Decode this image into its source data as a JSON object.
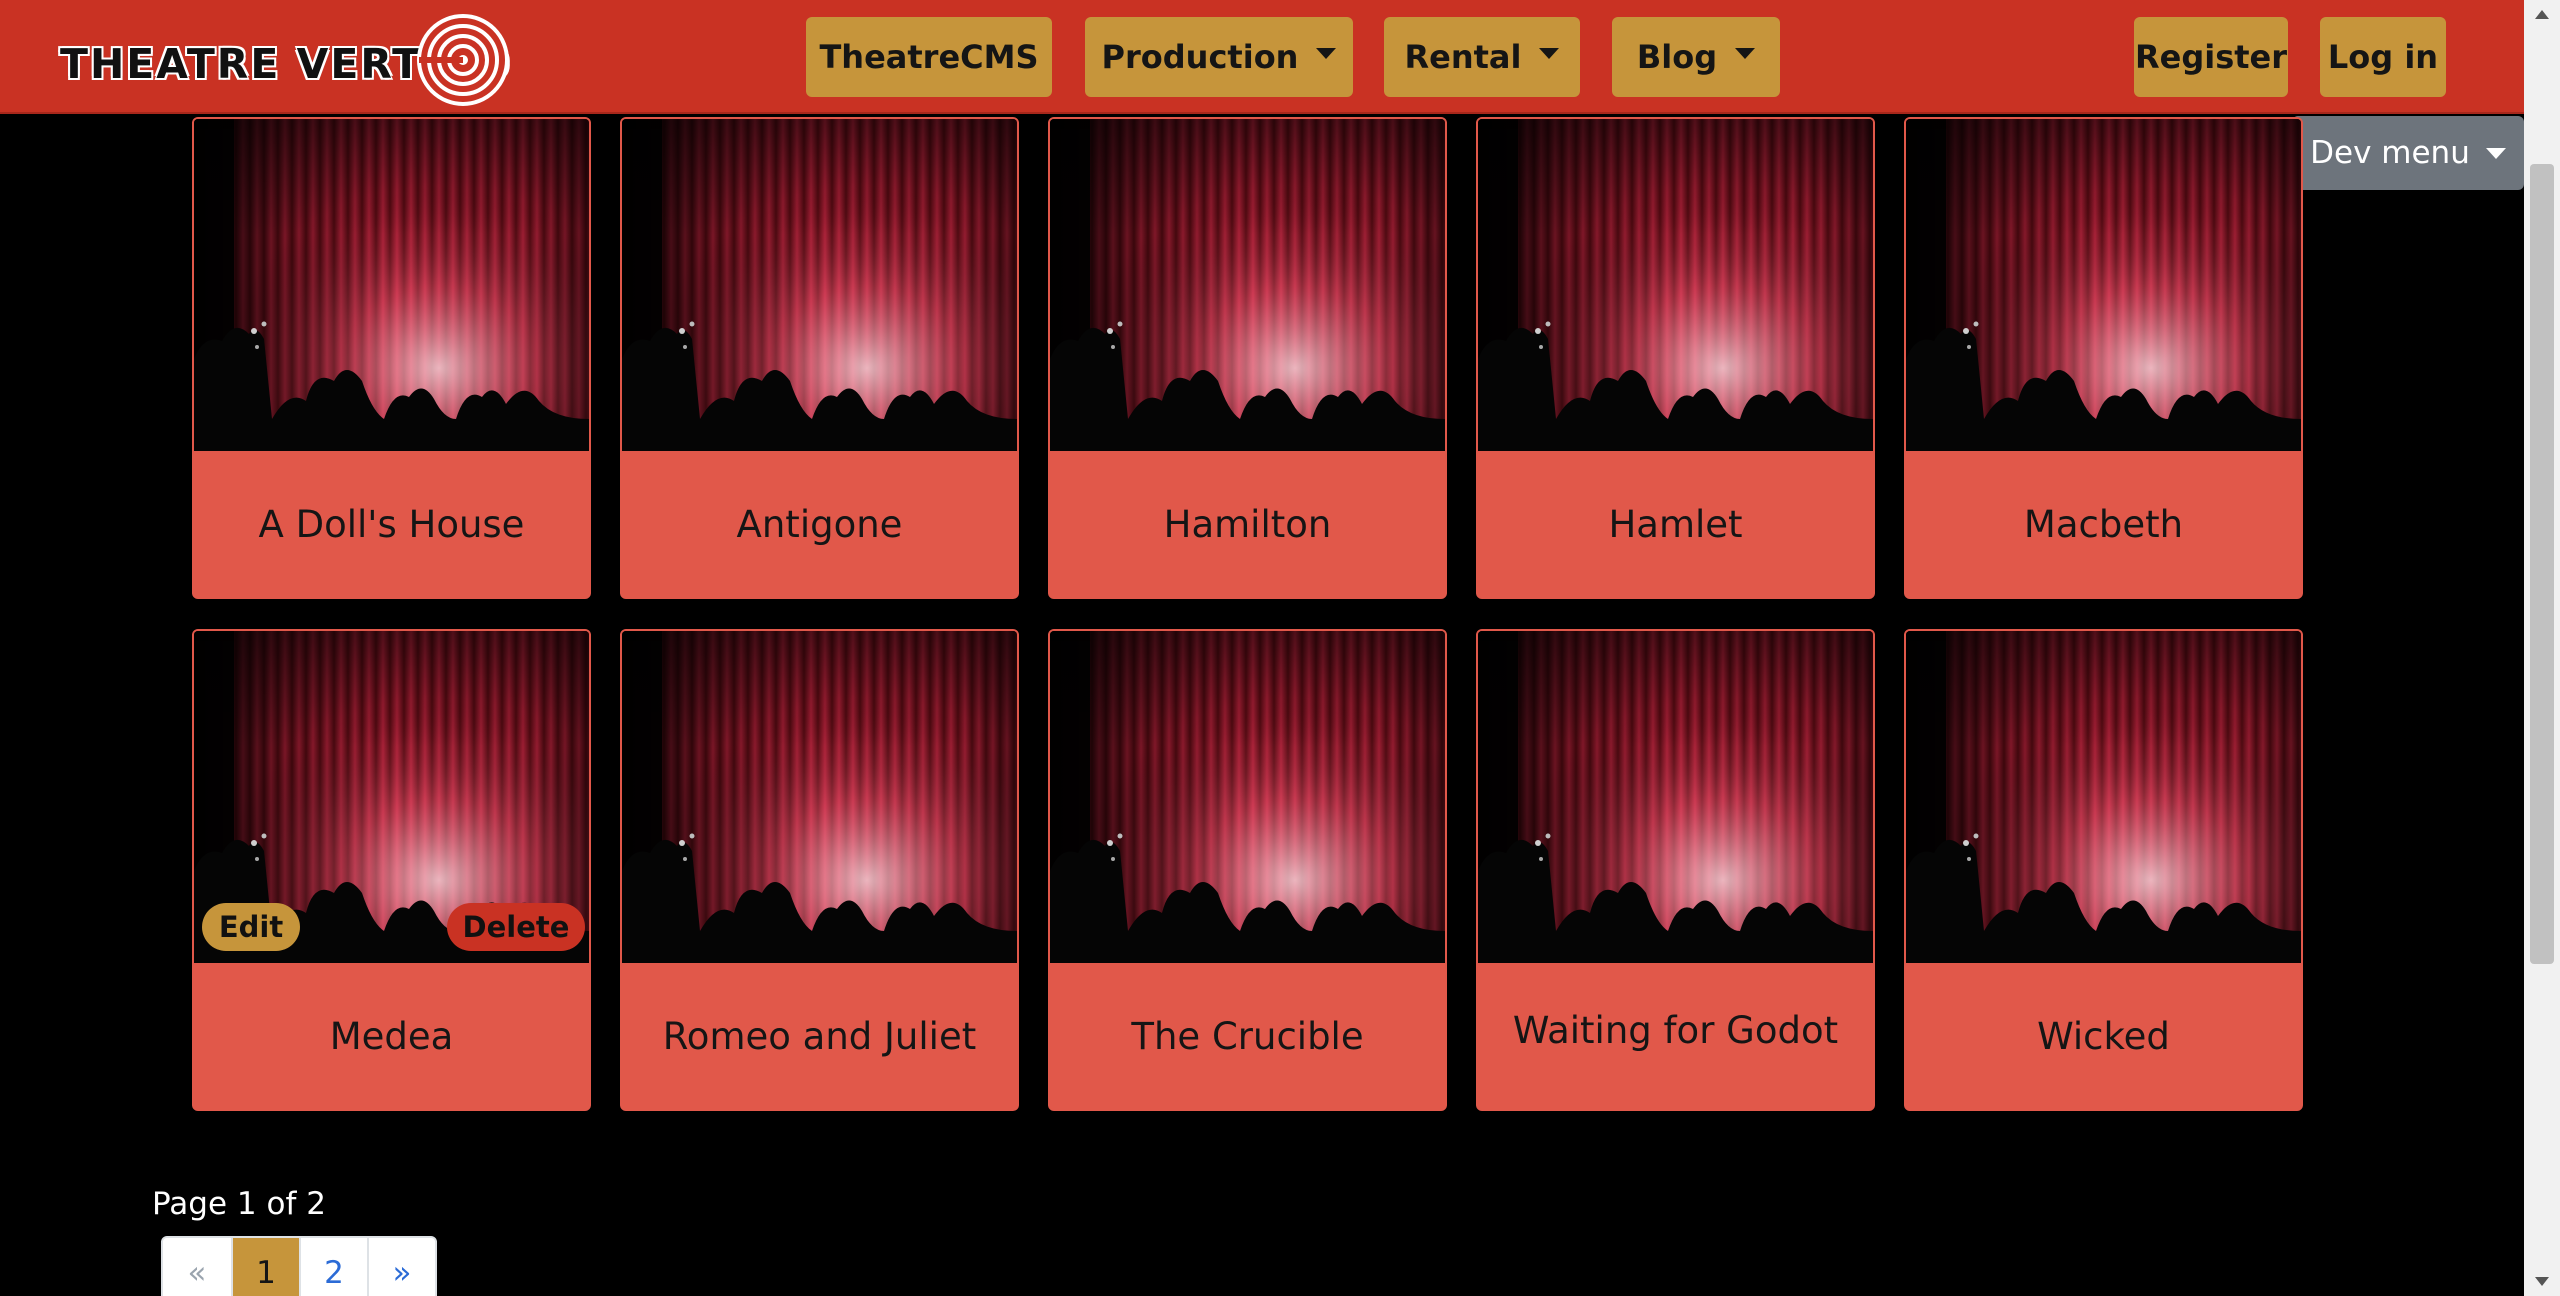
{
  "brand": {
    "name": "THEATRE VERTIGO"
  },
  "nav": {
    "items": [
      {
        "label": "TheatreCMS",
        "dropdown": false
      },
      {
        "label": "Production",
        "dropdown": true
      },
      {
        "label": "Rental",
        "dropdown": true
      },
      {
        "label": "Blog",
        "dropdown": true
      }
    ],
    "register_label": "Register",
    "login_label": "Log in"
  },
  "dev_menu": {
    "label": "Dev menu"
  },
  "productions": [
    {
      "title": "A Doll's House",
      "image": "red-stage-curtain"
    },
    {
      "title": "Antigone",
      "image": "red-stage-curtain"
    },
    {
      "title": "Hamilton",
      "image": "red-stage-curtain"
    },
    {
      "title": "Hamlet",
      "image": "red-stage-curtain"
    },
    {
      "title": "Macbeth",
      "image": "red-stage-curtain"
    },
    {
      "title": "Medea",
      "image": "red-stage-curtain",
      "actions": {
        "edit": "Edit",
        "delete": "Delete"
      }
    },
    {
      "title": "Romeo and Juliet",
      "image": "red-stage-curtain"
    },
    {
      "title": "The Crucible",
      "image": "red-stage-curtain"
    },
    {
      "title": "Waiting for Godot",
      "image": "red-stage-curtain"
    },
    {
      "title": "Wicked",
      "image": "red-stage-curtain"
    }
  ],
  "pagination": {
    "info": "Page 1 of 2",
    "prev": "«",
    "pages": [
      "1",
      "2"
    ],
    "current": "1",
    "next": "»"
  },
  "colors": {
    "navbar": "#c93223",
    "nav_button": "#c6953b",
    "card": "#e1584a",
    "dev_menu": "#6d747c",
    "background": "#000000"
  }
}
